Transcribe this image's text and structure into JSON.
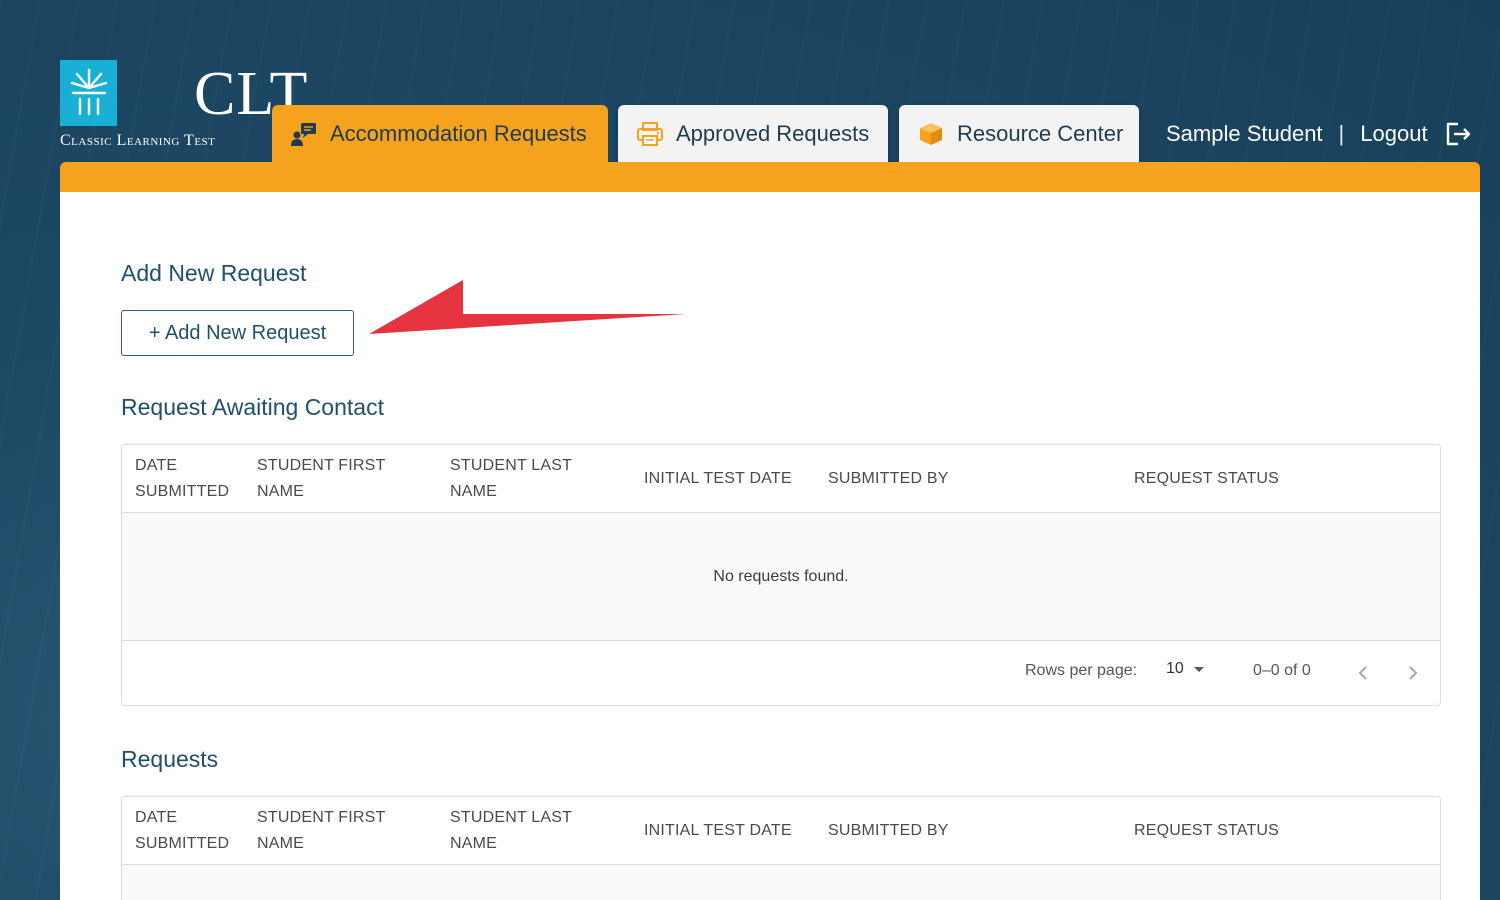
{
  "logo": {
    "mark": "CLT",
    "subtitle": "Classic Learning Test"
  },
  "tabs": [
    {
      "label": "Accommodation Requests",
      "icon": "chat-person-icon",
      "active": true
    },
    {
      "label": "Approved Requests",
      "icon": "printer-icon",
      "active": false
    },
    {
      "label": "Resource Center",
      "icon": "box-icon",
      "active": false
    }
  ],
  "user": {
    "name": "Sample Student",
    "separator": "|",
    "logout_label": "Logout"
  },
  "colors": {
    "accent_orange": "#f5a21e",
    "brand_blue": "#1ab0d6",
    "heading_blue": "#21506b",
    "arrow_red": "#e63340"
  },
  "add_section": {
    "title": "Add New Request",
    "button_label": "+ Add New Request"
  },
  "awaiting_section": {
    "title": "Request Awaiting Contact",
    "columns": [
      "DATE SUBMITTED",
      "STUDENT FIRST NAME",
      "STUDENT LAST NAME",
      "INITIAL TEST DATE",
      "SUBMITTED BY",
      "REQUEST STATUS"
    ],
    "empty_text": "No requests found.",
    "pagination": {
      "rows_per_page_label": "Rows per page:",
      "rows_per_page_value": "10",
      "range_text": "0–0 of 0"
    }
  },
  "requests_section": {
    "title": "Requests",
    "columns": [
      "DATE SUBMITTED",
      "STUDENT FIRST NAME",
      "STUDENT LAST NAME",
      "INITIAL TEST DATE",
      "SUBMITTED BY",
      "REQUEST STATUS"
    ]
  }
}
